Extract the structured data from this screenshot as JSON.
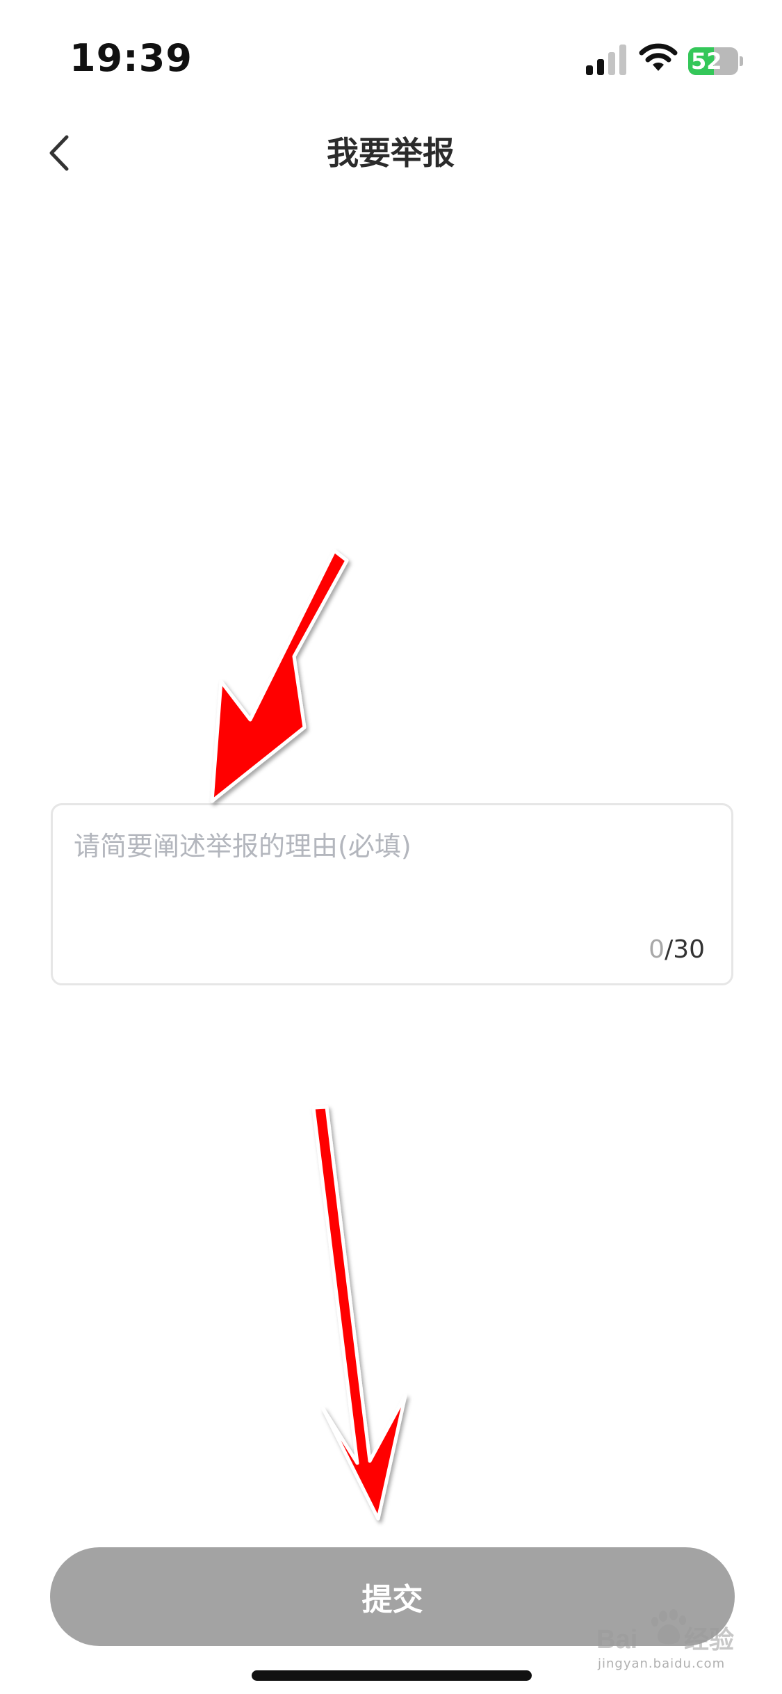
{
  "status_bar": {
    "time": "19:39",
    "battery_level": 52,
    "battery_text": "52",
    "signal_icon": "cellular-signal-icon",
    "wifi_icon": "wifi-icon",
    "battery_color": "#34c759"
  },
  "nav": {
    "back_icon": "chevron-left-icon",
    "title": "我要举报"
  },
  "report_form": {
    "placeholder": "请简要阐述举报的理由(必填)",
    "value": "",
    "count_current": "0",
    "count_max": "/30"
  },
  "submit": {
    "label": "提交",
    "color": "#a3a3a3"
  },
  "annotations": {
    "arrow_color": "#ff0000"
  },
  "watermark": {
    "logo_text": "Baidu经验",
    "sub_text": "jingyan.baidu.com"
  }
}
